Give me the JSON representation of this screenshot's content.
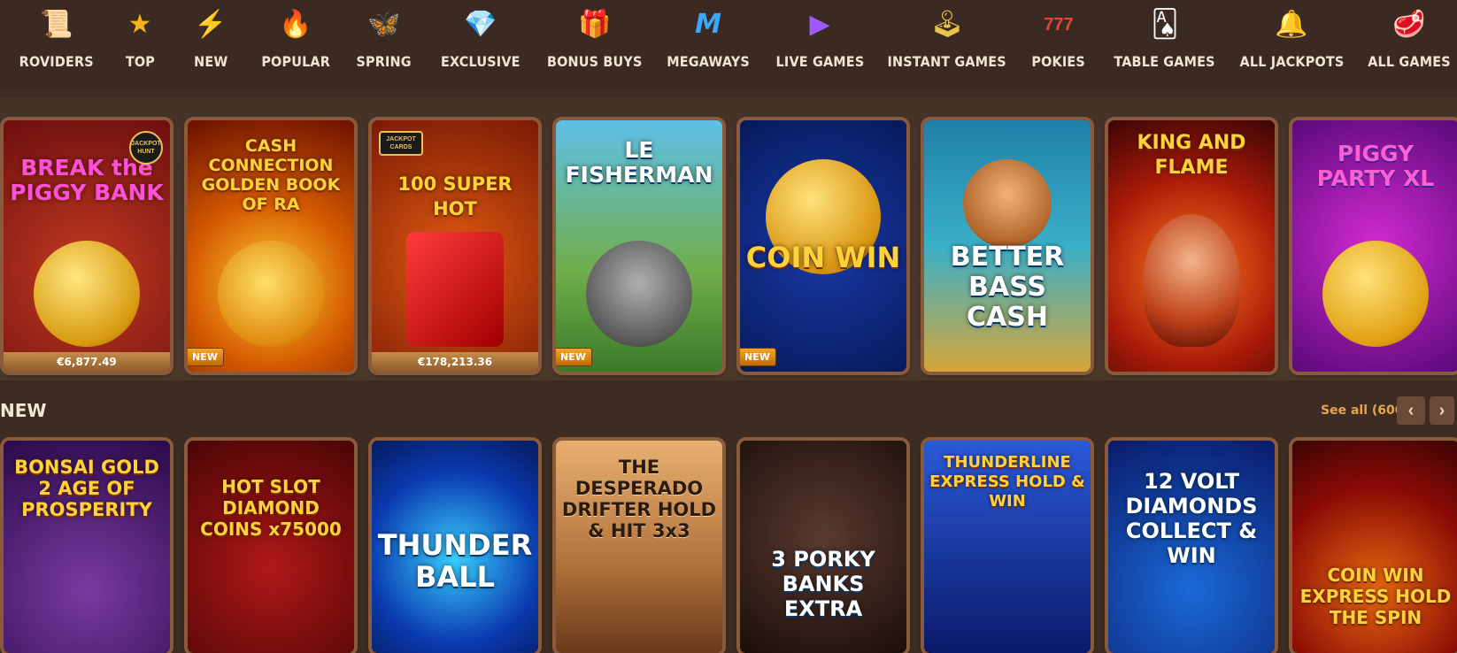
{
  "nav": {
    "items": [
      {
        "label": "ROVIDERS",
        "icon": "scroll-icon",
        "glyph": "📜"
      },
      {
        "label": "TOP",
        "icon": "star-icon",
        "glyph": "⭐"
      },
      {
        "label": "NEW",
        "icon": "lightning-icon",
        "glyph": "⚡"
      },
      {
        "label": "POPULAR",
        "icon": "flame-icon",
        "glyph": "🔥"
      },
      {
        "label": "SPRING",
        "icon": "butterfly-icon",
        "glyph": "🦋"
      },
      {
        "label": "EXCLUSIVE",
        "icon": "diamond-icon",
        "glyph": "💎"
      },
      {
        "label": "BONUS BUYS",
        "icon": "gift-icon",
        "glyph": "🎁"
      },
      {
        "label": "MEGAWAYS",
        "icon": "megaways-m-icon",
        "glyph": "M"
      },
      {
        "label": "LIVE GAMES",
        "icon": "play-icon",
        "glyph": "▶"
      },
      {
        "label": "INSTANT GAMES",
        "icon": "joystick-icon",
        "glyph": "🕹"
      },
      {
        "label": "POKIES",
        "icon": "slot-777-icon",
        "glyph": "777"
      },
      {
        "label": "TABLE GAMES",
        "icon": "playing-cards-icon",
        "glyph": "🂡"
      },
      {
        "label": "ALL JACKPOTS",
        "icon": "bell-icon",
        "glyph": "🔔"
      },
      {
        "label": "ALL GAMES",
        "icon": "meat-icon",
        "glyph": "🥩"
      }
    ]
  },
  "featured": {
    "games": [
      {
        "title": "BREAK the PIGGY BANK",
        "jackpot": "€6,877.49",
        "badge": "",
        "corner": "JACKPOT HUNT"
      },
      {
        "title": "CASH CONNECTION GOLDEN BOOK OF RA",
        "jackpot": "",
        "badge": "NEW",
        "corner": ""
      },
      {
        "title": "100 SUPER HOT",
        "jackpot": "€178,213.36",
        "badge": "",
        "corner": "JACKPOT CARDS"
      },
      {
        "title": "LE FISHERMAN",
        "jackpot": "",
        "badge": "NEW",
        "corner": ""
      },
      {
        "title": "COIN WIN",
        "jackpot": "",
        "badge": "NEW",
        "corner": ""
      },
      {
        "title": "BETTER BASS CASH",
        "jackpot": "",
        "badge": "",
        "corner": ""
      },
      {
        "title": "KING AND FLAME",
        "jackpot": "",
        "badge": "",
        "corner": ""
      },
      {
        "title": "PIGGY PARTY XL",
        "jackpot": "",
        "badge": "",
        "corner": ""
      }
    ]
  },
  "new_section": {
    "title": "NEW",
    "see_all": "See all (600)",
    "prev": "‹",
    "next": "›",
    "games": [
      {
        "title": "BONSAI GOLD 2 AGE OF PROSPERITY"
      },
      {
        "title": "HOT SLOT DIAMOND COINS x75000"
      },
      {
        "title": "THUNDER BALL"
      },
      {
        "title": "THE DESPERADO DRIFTER HOLD & HIT 3x3"
      },
      {
        "title": "3 PORKY BANKS EXTRA"
      },
      {
        "title": "THUNDERLINE EXPRESS HOLD & WIN"
      },
      {
        "title": "12 VOLT DIAMONDS COLLECT & WIN"
      },
      {
        "title": "COIN WIN EXPRESS HOLD THE SPIN"
      }
    ]
  }
}
